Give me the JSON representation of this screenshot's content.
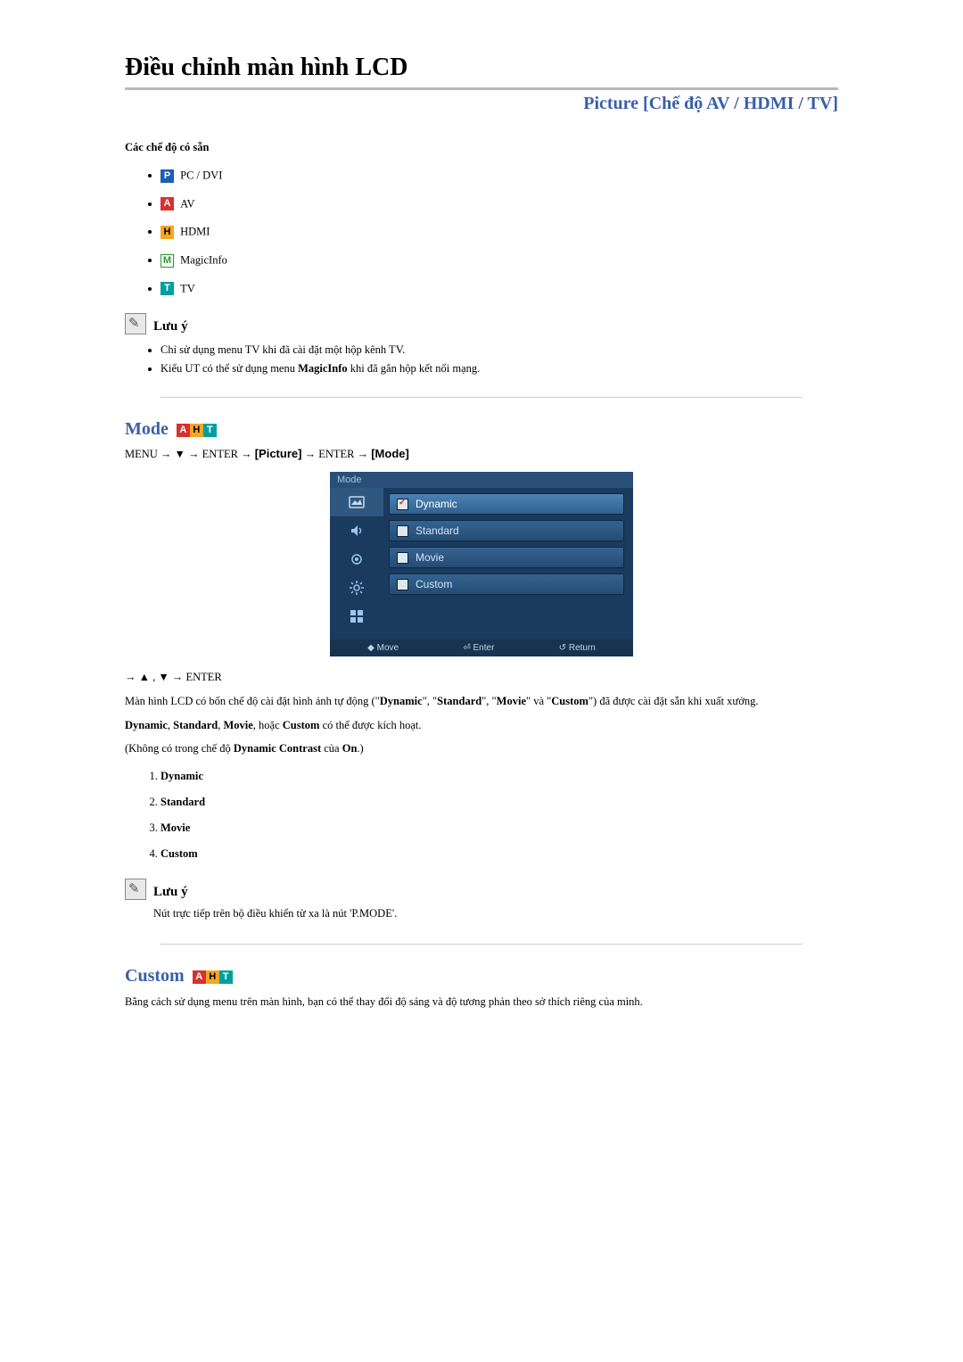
{
  "title": "Điều chỉnh màn hình LCD",
  "section": "Picture [Chế độ AV / HDMI / TV]",
  "modes_heading": "Các chế độ có sẵn",
  "modes": {
    "p": "PC / DVI",
    "a": "AV",
    "h": "HDMI",
    "m": "MagicInfo",
    "t": "TV"
  },
  "note_label": "Lưu ý",
  "note1_items": [
    "Chỉ sử dụng menu TV khi đã cài đặt một hộp kênh TV.",
    "Kiểu UT có thể sử dụng menu MagicInfo khi đã gắn hộp kết nối mạng."
  ],
  "mode_section": {
    "title": "Mode",
    "path_prefix": "MENU → ▼ → ENTER → ",
    "path_bracket1": "[Picture]",
    "path_mid": " → ENTER → ",
    "path_bracket2": "[Mode]",
    "osd": {
      "header": "Mode",
      "items": [
        "Dynamic",
        "Standard",
        "Movie",
        "Custom"
      ],
      "footer_move": "Move",
      "footer_enter": "Enter",
      "footer_return": "Return"
    },
    "nav": "→ ▲ , ▼ → ENTER",
    "para1_pre": "Màn hình LCD có bốn chế độ cài đặt hình ảnh tự động (\"",
    "para1_d": "Dynamic",
    "para1_s": "Standard",
    "para1_m": "Movie",
    "para1_and": "\" và \"",
    "para1_c": "Custom",
    "para1_post": "\") đã được cài đặt sẵn khi xuất xưởng.",
    "para2_pre": "",
    "para2_d": "Dynamic",
    "para2_s": "Standard",
    "para2_m": "Movie",
    "para2_or": ", hoặc ",
    "para2_c": "Custom",
    "para2_post": " có thể được kích hoạt.",
    "para3_pre": "(Không có trong chế độ ",
    "para3_dc": "Dynamic Contrast",
    "para3_mid": " của ",
    "para3_on": "On",
    "para3_post": ".)",
    "list": [
      "Dynamic",
      "Standard",
      "Movie",
      "Custom"
    ],
    "note2": "Nút trực tiếp trên bộ điều khiển từ xa là nút 'P.MODE'."
  },
  "custom_section": {
    "title": "Custom",
    "para": "Bằng cách sử dụng menu trên màn hình, bạn có thể thay đổi độ sáng và độ tương phản theo sở thích riêng của mình."
  },
  "sep_join": "\", \""
}
